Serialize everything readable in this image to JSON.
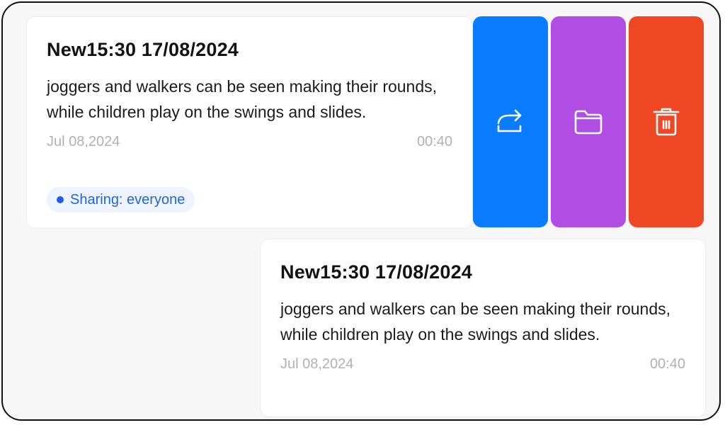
{
  "notes": [
    {
      "title": "New15:30 17/08/2024",
      "body": "joggers and walkers can be seen making their rounds, while children play on the swings and slides.",
      "date": "Jul 08,2024",
      "duration": "00:40",
      "sharing": "Sharing: everyone"
    },
    {
      "title": "New15:30 17/08/2024",
      "body": "joggers and walkers can be seen making their rounds, while children play on the swings and slides.",
      "date": "Jul 08,2024",
      "duration": "00:40"
    }
  ],
  "actions": [
    {
      "icon": "share-arrow-icon",
      "color": "#0a7cff"
    },
    {
      "icon": "folder-icon",
      "color": "#b04ee3"
    },
    {
      "icon": "trash-icon",
      "color": "#ef4623"
    }
  ],
  "colors": {
    "background": "#f7f7f8",
    "card": "#ffffff",
    "muted_text": "#b0b0b6",
    "pill_bg": "#eef4ff",
    "pill_text": "#2563d9"
  }
}
